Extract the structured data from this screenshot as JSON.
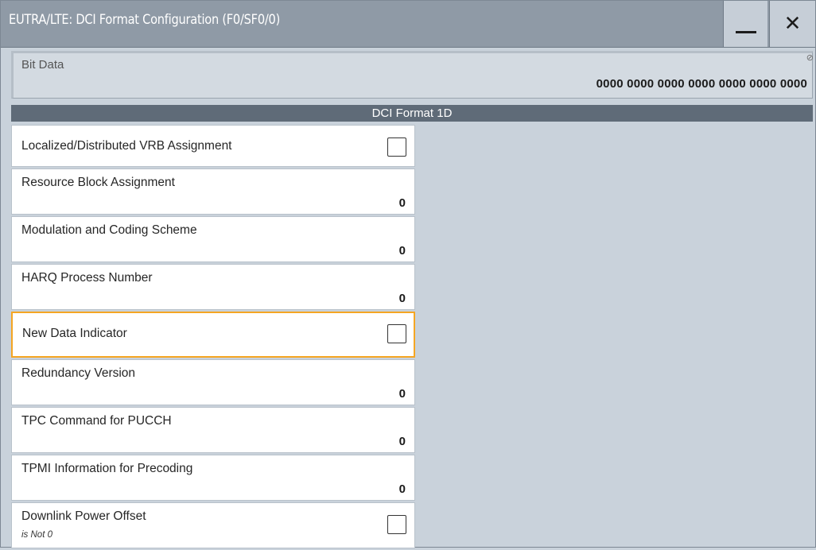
{
  "window": {
    "title": "EUTRA/LTE: DCI Format Configuration (F0/SF0/0)",
    "minimize_icon": "minimize-icon",
    "close_icon": "close-icon",
    "close_label": "✕"
  },
  "bit_data": {
    "label": "Bit Data",
    "value": "0000 0000 0000 0000 0000 0000 0000",
    "link_icon": "⊘"
  },
  "section": {
    "title": "DCI Format 1D"
  },
  "rows": [
    {
      "label": "Localized/Distributed VRB Assignment",
      "type": "checkbox",
      "checked": false
    },
    {
      "label": "Resource Block Assignment",
      "type": "value",
      "value": "0"
    },
    {
      "label": "Modulation and Coding Scheme",
      "type": "value",
      "value": "0"
    },
    {
      "label": "HARQ Process Number",
      "type": "value",
      "value": "0"
    },
    {
      "label": "New Data Indicator",
      "type": "checkbox",
      "checked": false,
      "focused": true
    },
    {
      "label": "Redundancy Version",
      "type": "value",
      "value": "0"
    },
    {
      "label": "TPC Command for PUCCH",
      "type": "value",
      "value": "0"
    },
    {
      "label": "TPMI Information for Precoding",
      "type": "value",
      "value": "0"
    },
    {
      "label": "Downlink Power Offset",
      "sublabel": "is Not 0",
      "type": "checkbox",
      "checked": false
    }
  ],
  "colors": {
    "focus": "#f5a623",
    "titlebar": "#8f9aa6",
    "section_header": "#5f6b78"
  }
}
